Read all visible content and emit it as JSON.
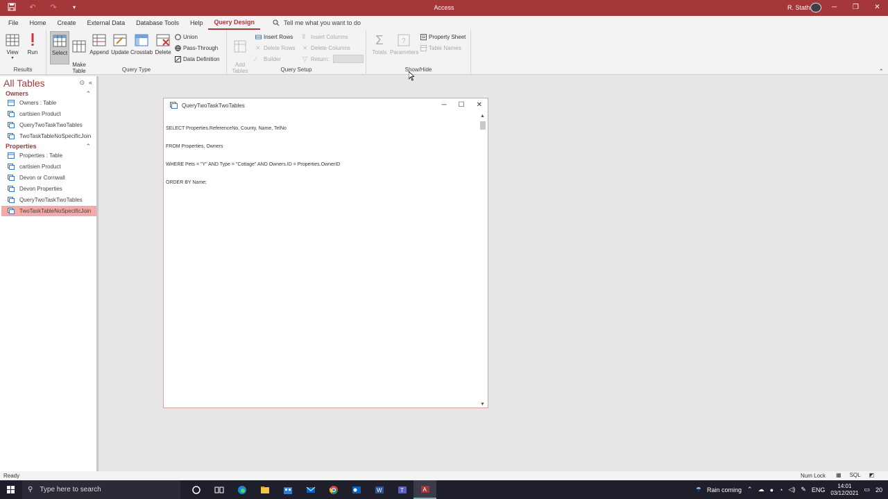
{
  "window": {
    "title": "Access",
    "user": "R. Statham"
  },
  "tabs": [
    "File",
    "Home",
    "Create",
    "External Data",
    "Database Tools",
    "Help",
    "Query Design"
  ],
  "active_tab": "Query Design",
  "tellme": "Tell me what you want to do",
  "ribbon": {
    "results": {
      "label": "Results",
      "view": "View",
      "run": "Run"
    },
    "query_type": {
      "label": "Query Type",
      "select": "Select",
      "make_table": "Make\nTable",
      "append": "Append",
      "update": "Update",
      "crosstab": "Crosstab",
      "delete": "Delete",
      "union": "Union",
      "pass_through": "Pass-Through",
      "data_definition": "Data Definition"
    },
    "query_setup": {
      "label": "Query Setup",
      "add_tables": "Add\nTables",
      "insert_rows": "Insert Rows",
      "delete_rows": "Delete Rows",
      "builder": "Builder",
      "insert_columns": "Insert Columns",
      "delete_columns": "Delete Columns",
      "return": "Return:"
    },
    "show_hide": {
      "label": "Show/Hide",
      "totals": "Totals",
      "parameters": "Parameters",
      "property_sheet": "Property Sheet",
      "table_names": "Table Names"
    }
  },
  "nav": {
    "header": "All Tables",
    "sections": [
      {
        "name": "Owners",
        "items": [
          "Owners : Table",
          "cartisien Product",
          "QueryTwoTaskTwoTables",
          "TwoTaskTableNoSpecificJoin"
        ]
      },
      {
        "name": "Properties",
        "items": [
          "Properties : Table",
          "cartisien Product",
          "Devon or Cornwall",
          "Devon Properties",
          "QueryTwoTaskTwoTables",
          "TwoTaskTableNoSpecificJoin"
        ]
      }
    ],
    "selected": "TwoTaskTableNoSpecificJoin"
  },
  "sql_window": {
    "title": "QueryTwoTaskTwoTables",
    "lines": [
      "SELECT Properties.ReferenceNo, County, Name, TelNo",
      "FROM Properties, Owners",
      "WHERE Pets = \"Y\" AND Type = \"Cottage\" AND Owners.ID = Properties.OwnerID",
      "ORDER BY Name;"
    ]
  },
  "status": {
    "left": "Ready",
    "numlock": "Num Lock",
    "sql": "SQL"
  },
  "taskbar": {
    "search_placeholder": "Type here to search",
    "weather": "Rain coming",
    "lang": "ENG",
    "time": "14:01",
    "date": "03/12/2021",
    "notifications": "20"
  },
  "colors": {
    "accent": "#a4373a",
    "selected_item": "#f4a8a8"
  }
}
